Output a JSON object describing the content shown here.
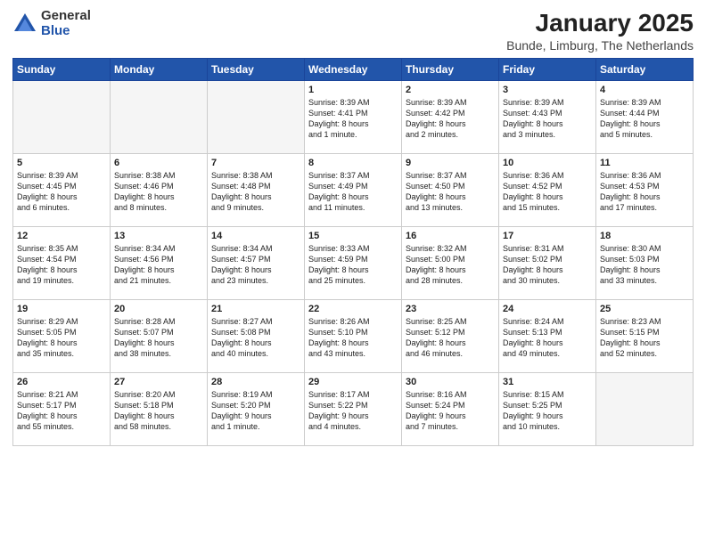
{
  "logo": {
    "general": "General",
    "blue": "Blue"
  },
  "title": "January 2025",
  "location": "Bunde, Limburg, The Netherlands",
  "weekdays": [
    "Sunday",
    "Monday",
    "Tuesday",
    "Wednesday",
    "Thursday",
    "Friday",
    "Saturday"
  ],
  "weeks": [
    [
      {
        "day": "",
        "info": ""
      },
      {
        "day": "",
        "info": ""
      },
      {
        "day": "",
        "info": ""
      },
      {
        "day": "1",
        "info": "Sunrise: 8:39 AM\nSunset: 4:41 PM\nDaylight: 8 hours\nand 1 minute."
      },
      {
        "day": "2",
        "info": "Sunrise: 8:39 AM\nSunset: 4:42 PM\nDaylight: 8 hours\nand 2 minutes."
      },
      {
        "day": "3",
        "info": "Sunrise: 8:39 AM\nSunset: 4:43 PM\nDaylight: 8 hours\nand 3 minutes."
      },
      {
        "day": "4",
        "info": "Sunrise: 8:39 AM\nSunset: 4:44 PM\nDaylight: 8 hours\nand 5 minutes."
      }
    ],
    [
      {
        "day": "5",
        "info": "Sunrise: 8:39 AM\nSunset: 4:45 PM\nDaylight: 8 hours\nand 6 minutes."
      },
      {
        "day": "6",
        "info": "Sunrise: 8:38 AM\nSunset: 4:46 PM\nDaylight: 8 hours\nand 8 minutes."
      },
      {
        "day": "7",
        "info": "Sunrise: 8:38 AM\nSunset: 4:48 PM\nDaylight: 8 hours\nand 9 minutes."
      },
      {
        "day": "8",
        "info": "Sunrise: 8:37 AM\nSunset: 4:49 PM\nDaylight: 8 hours\nand 11 minutes."
      },
      {
        "day": "9",
        "info": "Sunrise: 8:37 AM\nSunset: 4:50 PM\nDaylight: 8 hours\nand 13 minutes."
      },
      {
        "day": "10",
        "info": "Sunrise: 8:36 AM\nSunset: 4:52 PM\nDaylight: 8 hours\nand 15 minutes."
      },
      {
        "day": "11",
        "info": "Sunrise: 8:36 AM\nSunset: 4:53 PM\nDaylight: 8 hours\nand 17 minutes."
      }
    ],
    [
      {
        "day": "12",
        "info": "Sunrise: 8:35 AM\nSunset: 4:54 PM\nDaylight: 8 hours\nand 19 minutes."
      },
      {
        "day": "13",
        "info": "Sunrise: 8:34 AM\nSunset: 4:56 PM\nDaylight: 8 hours\nand 21 minutes."
      },
      {
        "day": "14",
        "info": "Sunrise: 8:34 AM\nSunset: 4:57 PM\nDaylight: 8 hours\nand 23 minutes."
      },
      {
        "day": "15",
        "info": "Sunrise: 8:33 AM\nSunset: 4:59 PM\nDaylight: 8 hours\nand 25 minutes."
      },
      {
        "day": "16",
        "info": "Sunrise: 8:32 AM\nSunset: 5:00 PM\nDaylight: 8 hours\nand 28 minutes."
      },
      {
        "day": "17",
        "info": "Sunrise: 8:31 AM\nSunset: 5:02 PM\nDaylight: 8 hours\nand 30 minutes."
      },
      {
        "day": "18",
        "info": "Sunrise: 8:30 AM\nSunset: 5:03 PM\nDaylight: 8 hours\nand 33 minutes."
      }
    ],
    [
      {
        "day": "19",
        "info": "Sunrise: 8:29 AM\nSunset: 5:05 PM\nDaylight: 8 hours\nand 35 minutes."
      },
      {
        "day": "20",
        "info": "Sunrise: 8:28 AM\nSunset: 5:07 PM\nDaylight: 8 hours\nand 38 minutes."
      },
      {
        "day": "21",
        "info": "Sunrise: 8:27 AM\nSunset: 5:08 PM\nDaylight: 8 hours\nand 40 minutes."
      },
      {
        "day": "22",
        "info": "Sunrise: 8:26 AM\nSunset: 5:10 PM\nDaylight: 8 hours\nand 43 minutes."
      },
      {
        "day": "23",
        "info": "Sunrise: 8:25 AM\nSunset: 5:12 PM\nDaylight: 8 hours\nand 46 minutes."
      },
      {
        "day": "24",
        "info": "Sunrise: 8:24 AM\nSunset: 5:13 PM\nDaylight: 8 hours\nand 49 minutes."
      },
      {
        "day": "25",
        "info": "Sunrise: 8:23 AM\nSunset: 5:15 PM\nDaylight: 8 hours\nand 52 minutes."
      }
    ],
    [
      {
        "day": "26",
        "info": "Sunrise: 8:21 AM\nSunset: 5:17 PM\nDaylight: 8 hours\nand 55 minutes."
      },
      {
        "day": "27",
        "info": "Sunrise: 8:20 AM\nSunset: 5:18 PM\nDaylight: 8 hours\nand 58 minutes."
      },
      {
        "day": "28",
        "info": "Sunrise: 8:19 AM\nSunset: 5:20 PM\nDaylight: 9 hours\nand 1 minute."
      },
      {
        "day": "29",
        "info": "Sunrise: 8:17 AM\nSunset: 5:22 PM\nDaylight: 9 hours\nand 4 minutes."
      },
      {
        "day": "30",
        "info": "Sunrise: 8:16 AM\nSunset: 5:24 PM\nDaylight: 9 hours\nand 7 minutes."
      },
      {
        "day": "31",
        "info": "Sunrise: 8:15 AM\nSunset: 5:25 PM\nDaylight: 9 hours\nand 10 minutes."
      },
      {
        "day": "",
        "info": ""
      }
    ]
  ]
}
